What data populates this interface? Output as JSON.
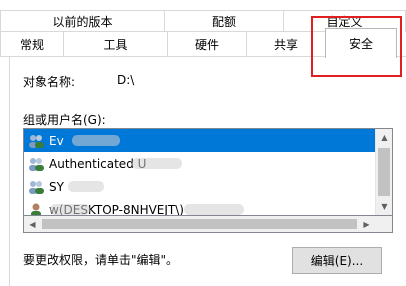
{
  "tabs_row1": [
    {
      "label": "以前的版本"
    },
    {
      "label": "配额"
    },
    {
      "label": "自定义"
    }
  ],
  "tabs_row2": [
    {
      "label": "常规"
    },
    {
      "label": "工具"
    },
    {
      "label": "硬件"
    },
    {
      "label": "共享"
    },
    {
      "label": "安全",
      "active": true
    }
  ],
  "object_name": {
    "label": "对象名称:",
    "value": "D:\\"
  },
  "group_label": "组或用户名(G):",
  "users": [
    {
      "name": "Ev",
      "icon": "group-icon",
      "selected": true
    },
    {
      "name": "Authenticated U",
      "icon": "group-icon",
      "selected": false
    },
    {
      "name": "SY",
      "icon": "group-icon",
      "selected": false
    },
    {
      "name": "w(DESKTOP-8NHVEJT\\)",
      "icon": "user-icon",
      "selected": false
    }
  ],
  "edit_hint": "要更改权限，请单击\"编辑\"。",
  "edit_button": "编辑(E)...",
  "colors": {
    "selection": "#0078d7",
    "highlight_box": "#e02020"
  }
}
